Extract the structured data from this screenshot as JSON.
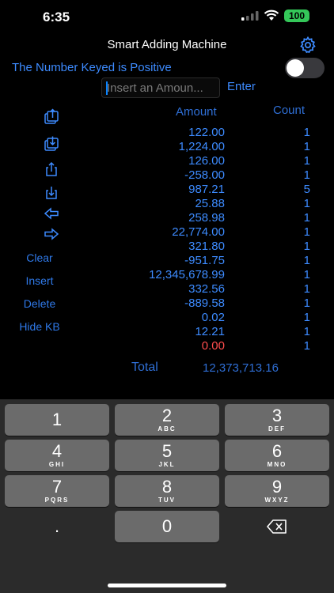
{
  "status": {
    "time": "6:35",
    "battery": "100"
  },
  "nav": {
    "title": "Smart Adding Machine",
    "settings_icon": "gear-icon"
  },
  "sign": {
    "label": "The Number Keyed is Positive",
    "toggle_on": false
  },
  "entry": {
    "placeholder": "Insert an Amoun...",
    "enter_label": "Enter"
  },
  "table": {
    "amount_header": "Amount",
    "count_header": "Count",
    "rows": [
      {
        "amount": "122.00",
        "count": "1"
      },
      {
        "amount": "1,224.00",
        "count": "1"
      },
      {
        "amount": "126.00",
        "count": "1"
      },
      {
        "amount": "-258.00",
        "count": "1"
      },
      {
        "amount": "987.21",
        "count": "5"
      },
      {
        "amount": "25.88",
        "count": "1"
      },
      {
        "amount": "258.98",
        "count": "1"
      },
      {
        "amount": "22,774.00",
        "count": "1"
      },
      {
        "amount": "321.80",
        "count": "1"
      },
      {
        "amount": "-951.75",
        "count": "1"
      },
      {
        "amount": "12,345,678.99",
        "count": "1"
      },
      {
        "amount": "332.56",
        "count": "1"
      },
      {
        "amount": "-889.58",
        "count": "1"
      },
      {
        "amount": "0.02",
        "count": "1"
      },
      {
        "amount": "12.21",
        "count": "1"
      },
      {
        "amount": "0.00",
        "count": "1"
      }
    ],
    "total_label": "Total",
    "total_value": "12,373,713.16"
  },
  "side": {
    "icons": [
      "share-doc-icon",
      "download-doc-icon",
      "share-icon",
      "download-icon",
      "arrow-left-icon",
      "arrow-right-icon"
    ],
    "buttons": {
      "clear": "Clear",
      "insert": "Insert",
      "delete": "Delete",
      "hide_kb": "Hide KB"
    }
  },
  "keyboard": {
    "keys": [
      {
        "num": "1",
        "letters": ""
      },
      {
        "num": "2",
        "letters": "ABC"
      },
      {
        "num": "3",
        "letters": "DEF"
      },
      {
        "num": "4",
        "letters": "GHI"
      },
      {
        "num": "5",
        "letters": "JKL"
      },
      {
        "num": "6",
        "letters": "MNO"
      },
      {
        "num": "7",
        "letters": "PQRS"
      },
      {
        "num": "8",
        "letters": "TUV"
      },
      {
        "num": "9",
        "letters": "WXYZ"
      }
    ],
    "dot": ".",
    "zero": "0",
    "backspace_icon": "backspace-icon"
  },
  "colors": {
    "accent": "#3d8bff",
    "zero_value": "#ff4d4d",
    "battery": "#34c759"
  }
}
